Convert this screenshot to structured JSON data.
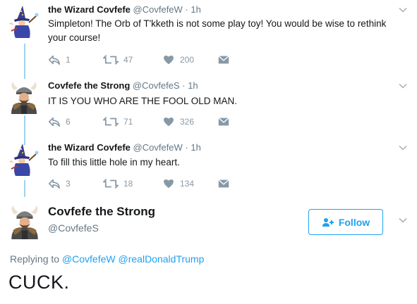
{
  "tweets": [
    {
      "name": "the Wizard Covfefe",
      "handle": "@CovfefeW",
      "dot": "·",
      "time": "1h",
      "text_lines": [
        "Simpleton! The Orb of T'kketh is not some play toy! You would be wise to rethink",
        "your course!"
      ],
      "avatar": "wizard-avatar",
      "replies": "1",
      "retweets": "47",
      "likes": "200"
    },
    {
      "name": "Covfefe the Strong",
      "handle": "@CovfefeS",
      "dot": "·",
      "time": "1h",
      "text_lines": [
        "IT IS YOU WHO ARE THE FOOL OLD MAN."
      ],
      "avatar": "viking-avatar",
      "replies": "6",
      "retweets": "71",
      "likes": "326"
    },
    {
      "name": "the Wizard Covfefe",
      "handle": "@CovfefeW",
      "dot": "·",
      "time": "1h",
      "text_lines": [
        "To fill this little hole in my heart."
      ],
      "avatar": "wizard-avatar",
      "replies": "3",
      "retweets": "18",
      "likes": "134"
    }
  ],
  "main": {
    "name": "Covfefe the Strong",
    "handle": "@CovfefeS",
    "avatar": "viking-avatar",
    "follow_label": "Follow",
    "replying_prefix": "Replying to",
    "reply_to_1": "@CovfefeW",
    "reply_to_2": "@realDonaldTrump",
    "text": "CUCK."
  },
  "colors": {
    "accent": "#1da1f2",
    "thread_line": "#9fd3f0",
    "muted": "#657786",
    "icon": "#8899a6"
  },
  "icons": [
    "reply-icon",
    "retweet-icon",
    "heart-icon",
    "dm-icon",
    "chevron-down-icon",
    "follow-person-icon"
  ]
}
